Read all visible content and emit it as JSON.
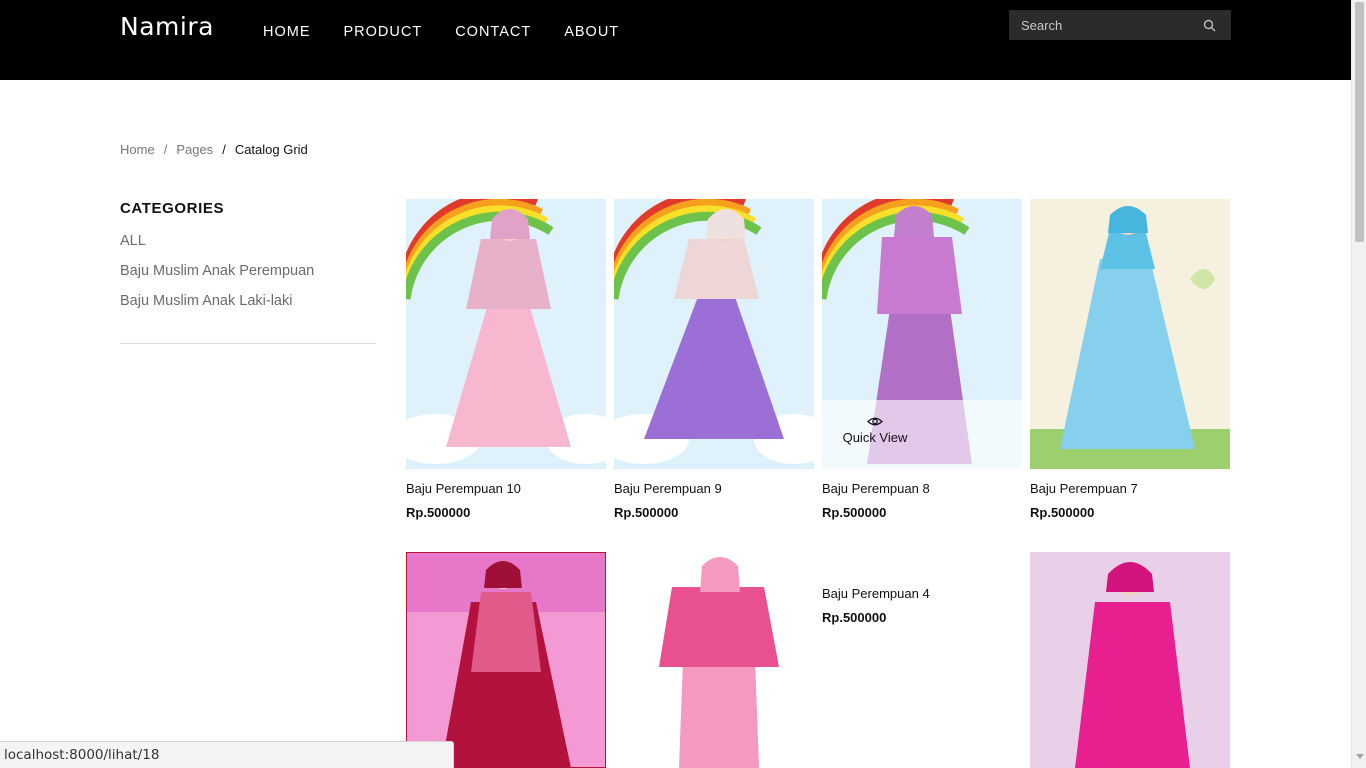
{
  "header": {
    "logo": "Namira",
    "nav": [
      "HOME",
      "PRODUCT",
      "CONTACT",
      "ABOUT"
    ],
    "search_placeholder": "Search"
  },
  "breadcrumb": {
    "items": [
      "Home",
      "Pages"
    ],
    "current": "Catalog Grid"
  },
  "sidebar": {
    "title": "CATEGORIES",
    "categories": [
      "ALL",
      "Baju Muslim Anak Perempuan",
      "Baju Muslim Anak Laki-laki"
    ]
  },
  "products": [
    {
      "name": "Baju Perempuan 10",
      "price": "Rp.500000",
      "dress_color": "#f7b7cf",
      "top_color": "#e7b1c9"
    },
    {
      "name": "Baju Perempuan 9",
      "price": "Rp.500000",
      "dress_color": "#9b6fd6",
      "top_color": "#efd6d6"
    },
    {
      "name": "Baju Perempuan 8",
      "price": "Rp.500000",
      "dress_color": "#b26fc6",
      "top_color": "#c77ad0"
    },
    {
      "name": "Baju Perempuan 7",
      "price": "Rp.500000",
      "dress_color": "#86d0ee",
      "top_color": "#5ec2e6"
    },
    {
      "name": "",
      "price": "",
      "dress_color": "#b3123c",
      "top_color": "#e05a8a"
    },
    {
      "name": "",
      "price": "",
      "dress_color": "#f49ac0",
      "top_color": "#e8508f"
    },
    {
      "name": "Baju Perempuan 4",
      "price": "Rp.500000"
    },
    {
      "name": "",
      "price": "",
      "dress_color": "#e8208f",
      "top_color": "#e8208f"
    }
  ],
  "quick_view_label": "Quick View",
  "status_bar": "localhost:8000/lihat/18"
}
